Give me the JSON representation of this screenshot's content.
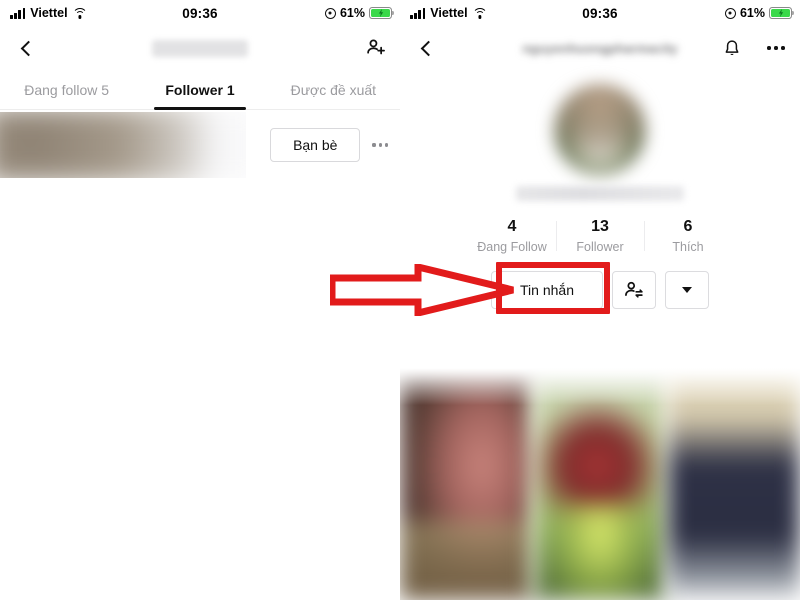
{
  "status_bar": {
    "carrier": "Viettel",
    "time": "09:36",
    "battery_percent": "61%",
    "signal_icon": "cellular-bars-icon",
    "wifi_icon": "wifi-icon",
    "location_icon": "location-services-icon",
    "battery_icon": "battery-charging-icon"
  },
  "left_panel": {
    "header": {
      "back_icon": "chevron-left-icon",
      "title_redacted": "",
      "add_friend_icon": "person-add-icon"
    },
    "tabs": [
      {
        "label": "Đang follow 5",
        "active": false,
        "name": "tab-dang-follow"
      },
      {
        "label": "Follower 1",
        "active": true,
        "name": "tab-follower"
      },
      {
        "label": "Được đề xuất",
        "active": false,
        "name": "tab-duoc-de-xuat"
      }
    ],
    "follower_row": {
      "name_redacted": "",
      "friend_button_label": "Bạn bè",
      "more_icon": "more-horizontal-icon"
    }
  },
  "right_panel": {
    "header": {
      "back_icon": "chevron-left-icon",
      "username_redacted": "nguyenhuongpharmacity",
      "bell_icon": "bell-icon",
      "more_icon": "more-horizontal-icon"
    },
    "profile": {
      "avatar_icon": "profile-avatar-blurred",
      "username_redacted": ""
    },
    "stats": [
      {
        "value": "4",
        "label": "Đang Follow",
        "name": "stat-dang-follow"
      },
      {
        "value": "13",
        "label": "Follower",
        "name": "stat-follower"
      },
      {
        "value": "6",
        "label": "Thích",
        "name": "stat-thich"
      }
    ],
    "actions": {
      "message_button_label": "Tin nhắn",
      "suggest_friends_icon": "person-swap-icon",
      "dropdown_icon": "chevron-down-icon"
    },
    "photo_grid": {
      "columns": 3,
      "cells": [
        "post-thumbnail-1",
        "post-thumbnail-2",
        "post-thumbnail-3"
      ]
    }
  },
  "annotation": {
    "highlight_color": "#e21b1b",
    "arrow_icon": "right-arrow-annotation",
    "highlight_target": "Tin nhắn"
  }
}
